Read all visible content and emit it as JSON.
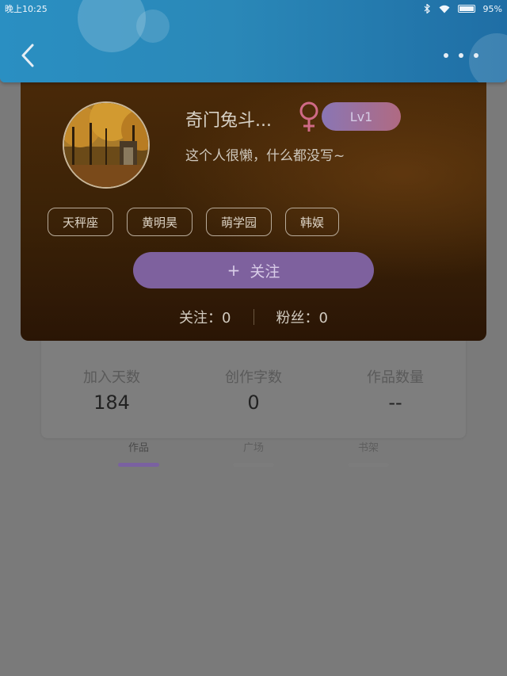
{
  "status_bar": {
    "time": "晚上10:25",
    "battery": "95%"
  },
  "header": {
    "back_icon": "chevron-left-icon",
    "more_icon": "more-dots-icon"
  },
  "profile": {
    "nickname": "奇门兔斗...",
    "gender_icon": "female-icon",
    "level": "Lv1",
    "signature": "这个人很懒，什么都没写~",
    "tags": [
      "天秤座",
      "黄明昊",
      "萌学园",
      "韩娱"
    ],
    "follow_button": {
      "icon": "+",
      "label": "关注"
    },
    "following_label": "关注：0",
    "fans_label": "粉丝：0"
  },
  "stats": [
    {
      "label": "加入天数",
      "value": "184"
    },
    {
      "label": "创作字数",
      "value": "0"
    },
    {
      "label": "作品数量",
      "value": "--"
    }
  ],
  "tabs": [
    {
      "label": "作品",
      "active": true
    },
    {
      "label": "广场",
      "active": false
    },
    {
      "label": "书架",
      "active": false
    }
  ],
  "colors": {
    "header_blue": "#2a88b8",
    "card_brown": "#3b2207",
    "accent_purple": "#7e619e",
    "female_pink": "#d06a86"
  }
}
